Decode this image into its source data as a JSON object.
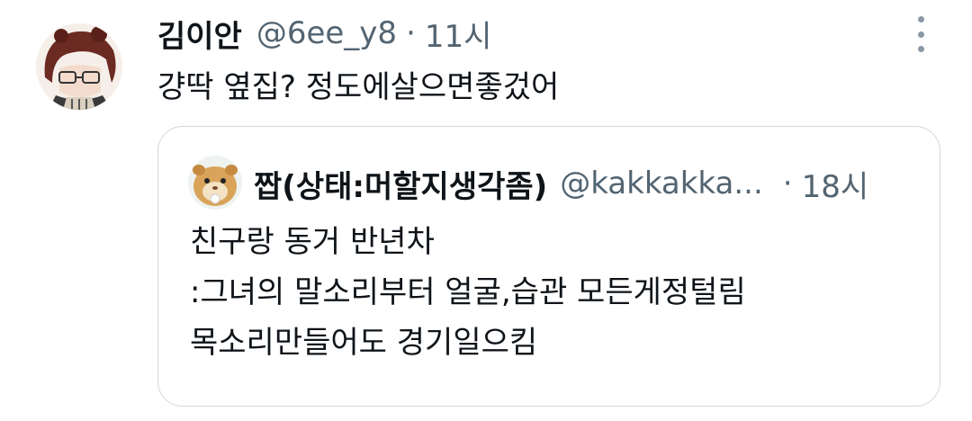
{
  "tweet": {
    "author_name": "김이안",
    "author_handle": "@6ee_y8",
    "separator": "·",
    "time": "11시",
    "text": "걍딱 옆집? 정도에살으면좋겄어",
    "avatar_icon": "anime-character-avatar-icon",
    "more_icon": "more-vertical-icon"
  },
  "quote": {
    "author_name": "짭(상태:머할지생각좀)",
    "author_handle": "@kakkakka...",
    "separator": "·",
    "time": "18시",
    "avatar_icon": "hamster-avatar-icon",
    "lines": [
      "친구랑 동거 반년차",
      ":그녀의 말소리부터 얼굴,습관 모든게정털림",
      "목소리만들어도 경기일으킴"
    ]
  },
  "colors": {
    "text": "#0f1419",
    "secondary": "#536471",
    "border": "#cfd9de",
    "icon": "#8b98a5"
  }
}
